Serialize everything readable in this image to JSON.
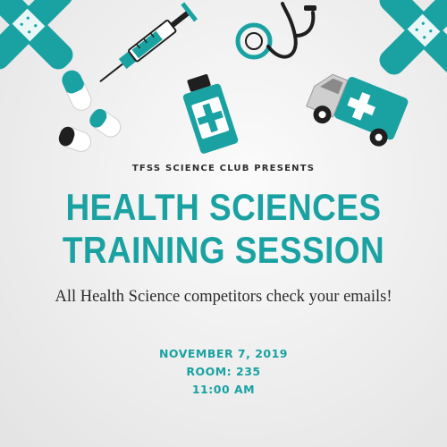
{
  "poster": {
    "presenter": "TFSS SCIENCE CLUB PRESENTS",
    "title_line1": "HEALTH SCIENCES",
    "title_line2": "TRAINING SESSION",
    "message": "All Health Science competitors check your emails!",
    "date": "NOVEMBER 7, 2019",
    "room": "ROOM: 235",
    "time": "11:00 AM"
  },
  "colors": {
    "accent": "#1aa2a2",
    "dark": "#1f1f1f",
    "text": "#2b2b2b"
  },
  "icons": [
    "bandage-icon",
    "syringe-icon",
    "stethoscope-icon",
    "pill-capsule-icon",
    "medicine-bottle-icon",
    "ambulance-icon"
  ]
}
